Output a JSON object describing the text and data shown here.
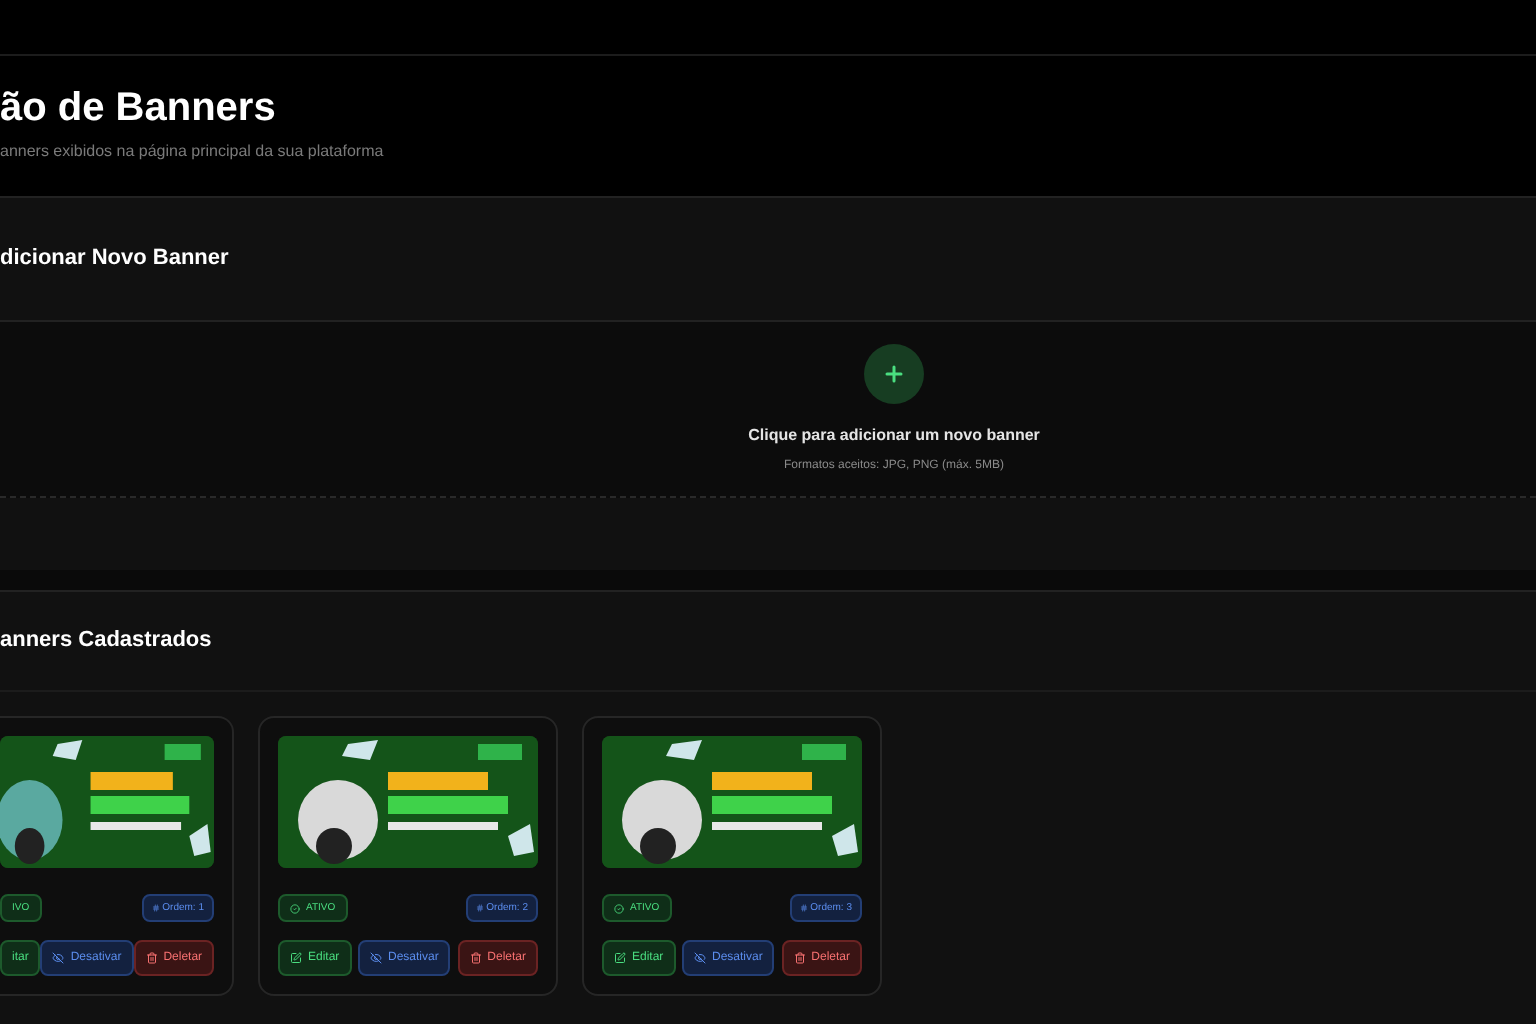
{
  "header": {
    "title": "ão de Banners",
    "subtitle": "anners exibidos na página principal da sua plataforma"
  },
  "add_section": {
    "title": "dicionar Novo Banner",
    "upload": {
      "label": "Clique para adicionar um novo banner",
      "hint": "Formatos aceitos: JPG, PNG (máx. 5MB)"
    }
  },
  "list_section": {
    "title": "anners Cadastrados",
    "cards": [
      {
        "cut_left": true,
        "status": "IVO",
        "order": "Ordem: 1",
        "actions": [
          {
            "kind": "edit",
            "label": "itar"
          },
          {
            "kind": "disable",
            "label": "Desativar"
          },
          {
            "kind": "delete",
            "label": "Deletar"
          }
        ]
      },
      {
        "cut_left": false,
        "status": "ATIVO",
        "order": "Ordem: 2",
        "actions": [
          {
            "kind": "edit",
            "label": "Editar"
          },
          {
            "kind": "disable",
            "label": "Desativar"
          },
          {
            "kind": "delete",
            "label": "Deletar"
          }
        ]
      },
      {
        "cut_left": false,
        "status": "ATIVO",
        "order": "Ordem: 3",
        "actions": [
          {
            "kind": "edit",
            "label": "Editar"
          },
          {
            "kind": "disable",
            "label": "Desativar"
          },
          {
            "kind": "delete",
            "label": "Deletar"
          }
        ]
      }
    ]
  }
}
